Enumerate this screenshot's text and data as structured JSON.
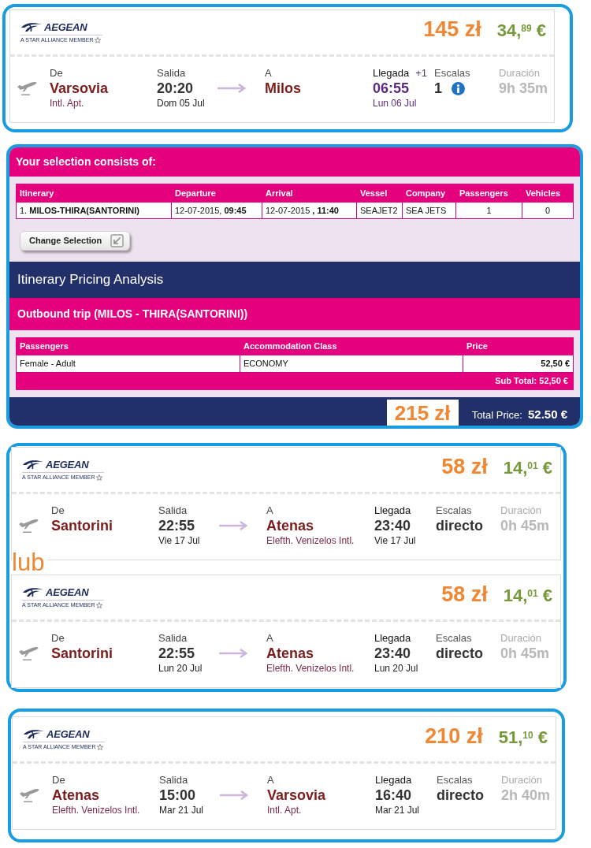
{
  "groups": [
    {
      "kind": "flights",
      "flights": [
        {
          "airline": {
            "name": "AEGEAN",
            "tagline": "A STAR ALLIANCE MEMBER"
          },
          "price_pln": "145 zł",
          "price_eur": "34,$^{89}$ €",
          "from": {
            "label": "De",
            "city": "Varsovia",
            "airport": "Intl. Apt."
          },
          "departure": {
            "label": "Salida",
            "time": "20:20",
            "date": "Dom 05 Jul"
          },
          "to": {
            "label": "A",
            "city": "Milos"
          },
          "arrival": {
            "label": "Llegada",
            "day_offset": "+1",
            "time": "06:55",
            "date": "Lun 06 Jul"
          },
          "stops": {
            "label": "Escalas",
            "value": "1",
            "info": true
          },
          "duration": {
            "label": "Duración",
            "value": "9h 35m"
          }
        }
      ]
    },
    {
      "kind": "ferry",
      "title": "Your selection consists of:",
      "selection_table": {
        "columns": [
          "Itinerary",
          "Departure",
          "Arrival",
          "Vessel",
          "Company",
          "Passengers",
          "Vehicles"
        ],
        "rows": [
          [
            "1. **MILOS-THIRA(SANTORINI)**",
            "12-07-2015, **09:45**",
            "12-07-2015 **, 11:40**",
            "SEAJET2",
            "SEA JETS",
            "1",
            "0"
          ]
        ]
      },
      "change_button": "Change Selection",
      "pricing_title": "Itinerary Pricing Analysis",
      "trip_title": "Outbound trip (MILOS - THIRA(SANTORINI))",
      "price_table": {
        "columns": [
          "Passengers",
          "Accommodation Class",
          "Price"
        ],
        "rows": [
          [
            "Female - Adult",
            "ECONOMY",
            "52,50 €"
          ]
        ],
        "subtotal": "Sub Total: 52,50 €"
      },
      "price_pln": "215 zł",
      "total": {
        "label": "Total Price:",
        "value": "52.50 €"
      }
    },
    {
      "kind": "flights",
      "separator": "lub",
      "flights": [
        {
          "airline": {
            "name": "AEGEAN",
            "tagline": "A STAR ALLIANCE MEMBER"
          },
          "price_pln": "58 zł",
          "price_eur": "14,$^{01}$ €",
          "from": {
            "label": "De",
            "city": "Santorini"
          },
          "departure": {
            "label": "Salida",
            "time": "22:55",
            "date": "Vie 17 Jul"
          },
          "to": {
            "label": "A",
            "city": "Atenas",
            "airport": "Elefth. Venizelos Intl."
          },
          "arrival": {
            "label": "Llegada",
            "time": "23:40",
            "date": "Vie 17 Jul"
          },
          "stops": {
            "label": "Escalas",
            "value": "directo",
            "info": false
          },
          "duration": {
            "label": "Duración",
            "value": "0h 45m"
          }
        },
        {
          "airline": {
            "name": "AEGEAN",
            "tagline": "A STAR ALLIANCE MEMBER"
          },
          "price_pln": "58 zł",
          "price_eur": "14,$^{01}$ €",
          "from": {
            "label": "De",
            "city": "Santorini"
          },
          "departure": {
            "label": "Salida",
            "time": "22:55",
            "date": "Lun 20 Jul"
          },
          "to": {
            "label": "A",
            "city": "Atenas",
            "airport": "Elefth. Venizelos Intl."
          },
          "arrival": {
            "label": "Llegada",
            "time": "23:40",
            "date": "Lun 20 Jul"
          },
          "stops": {
            "label": "Escalas",
            "value": "directo",
            "info": false
          },
          "duration": {
            "label": "Duración",
            "value": "0h 45m"
          }
        }
      ]
    },
    {
      "kind": "flights",
      "flights": [
        {
          "airline": {
            "name": "AEGEAN",
            "tagline": "A STAR ALLIANCE MEMBER"
          },
          "price_pln": "210 zł",
          "price_eur": "51,$^{10}$ €",
          "from": {
            "label": "De",
            "city": "Atenas",
            "airport": "Elefth. Venizelos Intl."
          },
          "departure": {
            "label": "Salida",
            "time": "15:00",
            "date": "Mar 21 Jul"
          },
          "to": {
            "label": "A",
            "city": "Varsovia",
            "airport": "Intl. Apt."
          },
          "arrival": {
            "label": "Llegada",
            "time": "16:40",
            "date": "Mar 21 Jul"
          },
          "stops": {
            "label": "Escalas",
            "value": "directo",
            "info": false
          },
          "duration": {
            "label": "Duración",
            "value": "2h 40m"
          }
        }
      ]
    }
  ]
}
